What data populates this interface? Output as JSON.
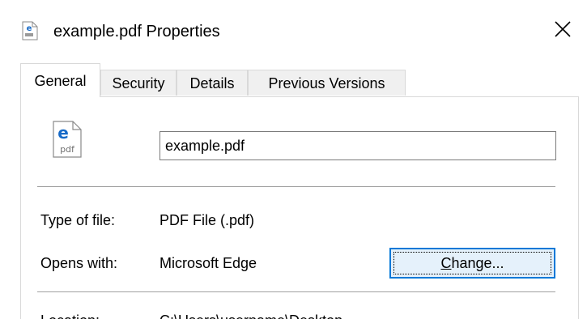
{
  "window": {
    "title": "example.pdf Properties",
    "close_label": "Close"
  },
  "tabs": [
    {
      "label": "General",
      "active": true
    },
    {
      "label": "Security",
      "active": false
    },
    {
      "label": "Details",
      "active": false
    },
    {
      "label": "Previous Versions",
      "active": false
    }
  ],
  "general": {
    "file_name": "example.pdf",
    "type_label": "Type of file:",
    "type_value": "PDF File (.pdf)",
    "opens_label": "Opens with:",
    "opens_value": "Microsoft Edge",
    "change_button": {
      "accel": "C",
      "rest": "hange..."
    },
    "location_label": "Location:",
    "location_value": "C:\\Users\\username\\Desktop"
  },
  "colors": {
    "accent": "#0078d7",
    "button_bg": "#e5f1fb",
    "edge_icon": "#1569c7"
  },
  "icons": {
    "title_icon": "pdf-edge-file-icon",
    "large_icon": "pdf-edge-file-icon",
    "close": "close-icon"
  }
}
